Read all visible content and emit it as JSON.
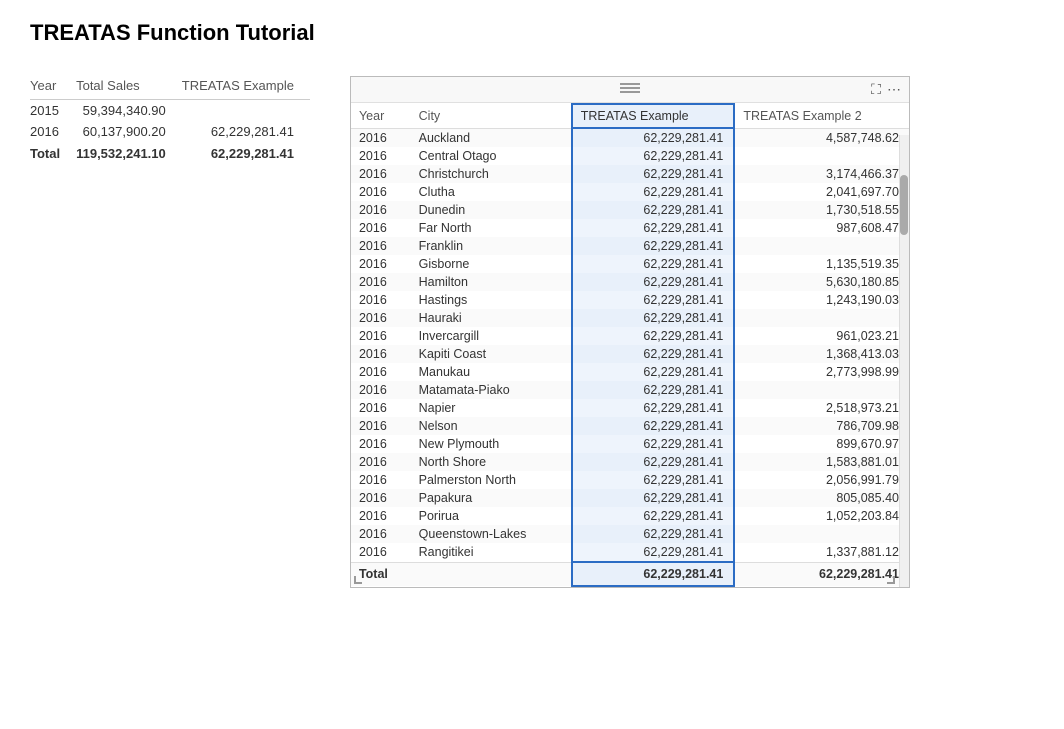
{
  "title": "TREATAS Function Tutorial",
  "left_table": {
    "headers": [
      "Year",
      "Total Sales",
      "TREATAS Example"
    ],
    "rows": [
      {
        "year": "2015",
        "total_sales": "59,394,340.90",
        "treatas_example": ""
      },
      {
        "year": "2016",
        "total_sales": "60,137,900.20",
        "treatas_example": "62,229,281.41"
      },
      {
        "year": "Total",
        "total_sales": "119,532,241.10",
        "treatas_example": "62,229,281.41",
        "is_total": true
      }
    ]
  },
  "right_table": {
    "headers": [
      "Year",
      "City",
      "TREATAS Example",
      "TREATAS Example 2"
    ],
    "rows": [
      {
        "year": "2016",
        "city": "Auckland",
        "treatas": "62,229,281.41",
        "treatas2": "4,587,748.62"
      },
      {
        "year": "2016",
        "city": "Central Otago",
        "treatas": "62,229,281.41",
        "treatas2": ""
      },
      {
        "year": "2016",
        "city": "Christchurch",
        "treatas": "62,229,281.41",
        "treatas2": "3,174,466.37"
      },
      {
        "year": "2016",
        "city": "Clutha",
        "treatas": "62,229,281.41",
        "treatas2": "2,041,697.70"
      },
      {
        "year": "2016",
        "city": "Dunedin",
        "treatas": "62,229,281.41",
        "treatas2": "1,730,518.55"
      },
      {
        "year": "2016",
        "city": "Far North",
        "treatas": "62,229,281.41",
        "treatas2": "987,608.47"
      },
      {
        "year": "2016",
        "city": "Franklin",
        "treatas": "62,229,281.41",
        "treatas2": ""
      },
      {
        "year": "2016",
        "city": "Gisborne",
        "treatas": "62,229,281.41",
        "treatas2": "1,135,519.35"
      },
      {
        "year": "2016",
        "city": "Hamilton",
        "treatas": "62,229,281.41",
        "treatas2": "5,630,180.85"
      },
      {
        "year": "2016",
        "city": "Hastings",
        "treatas": "62,229,281.41",
        "treatas2": "1,243,190.03"
      },
      {
        "year": "2016",
        "city": "Hauraki",
        "treatas": "62,229,281.41",
        "treatas2": ""
      },
      {
        "year": "2016",
        "city": "Invercargill",
        "treatas": "62,229,281.41",
        "treatas2": "961,023.21"
      },
      {
        "year": "2016",
        "city": "Kapiti Coast",
        "treatas": "62,229,281.41",
        "treatas2": "1,368,413.03"
      },
      {
        "year": "2016",
        "city": "Manukau",
        "treatas": "62,229,281.41",
        "treatas2": "2,773,998.99"
      },
      {
        "year": "2016",
        "city": "Matamata-Piako",
        "treatas": "62,229,281.41",
        "treatas2": ""
      },
      {
        "year": "2016",
        "city": "Napier",
        "treatas": "62,229,281.41",
        "treatas2": "2,518,973.21"
      },
      {
        "year": "2016",
        "city": "Nelson",
        "treatas": "62,229,281.41",
        "treatas2": "786,709.98"
      },
      {
        "year": "2016",
        "city": "New Plymouth",
        "treatas": "62,229,281.41",
        "treatas2": "899,670.97"
      },
      {
        "year": "2016",
        "city": "North Shore",
        "treatas": "62,229,281.41",
        "treatas2": "1,583,881.01"
      },
      {
        "year": "2016",
        "city": "Palmerston North",
        "treatas": "62,229,281.41",
        "treatas2": "2,056,991.79"
      },
      {
        "year": "2016",
        "city": "Papakura",
        "treatas": "62,229,281.41",
        "treatas2": "805,085.40"
      },
      {
        "year": "2016",
        "city": "Porirua",
        "treatas": "62,229,281.41",
        "treatas2": "1,052,203.84"
      },
      {
        "year": "2016",
        "city": "Queenstown-Lakes",
        "treatas": "62,229,281.41",
        "treatas2": ""
      },
      {
        "year": "2016",
        "city": "Rangitikei",
        "treatas": "62,229,281.41",
        "treatas2": "1,337,881.12"
      }
    ],
    "total_row": {
      "label": "Total",
      "treatas": "62,229,281.41",
      "treatas2": "62,229,281.41"
    }
  }
}
